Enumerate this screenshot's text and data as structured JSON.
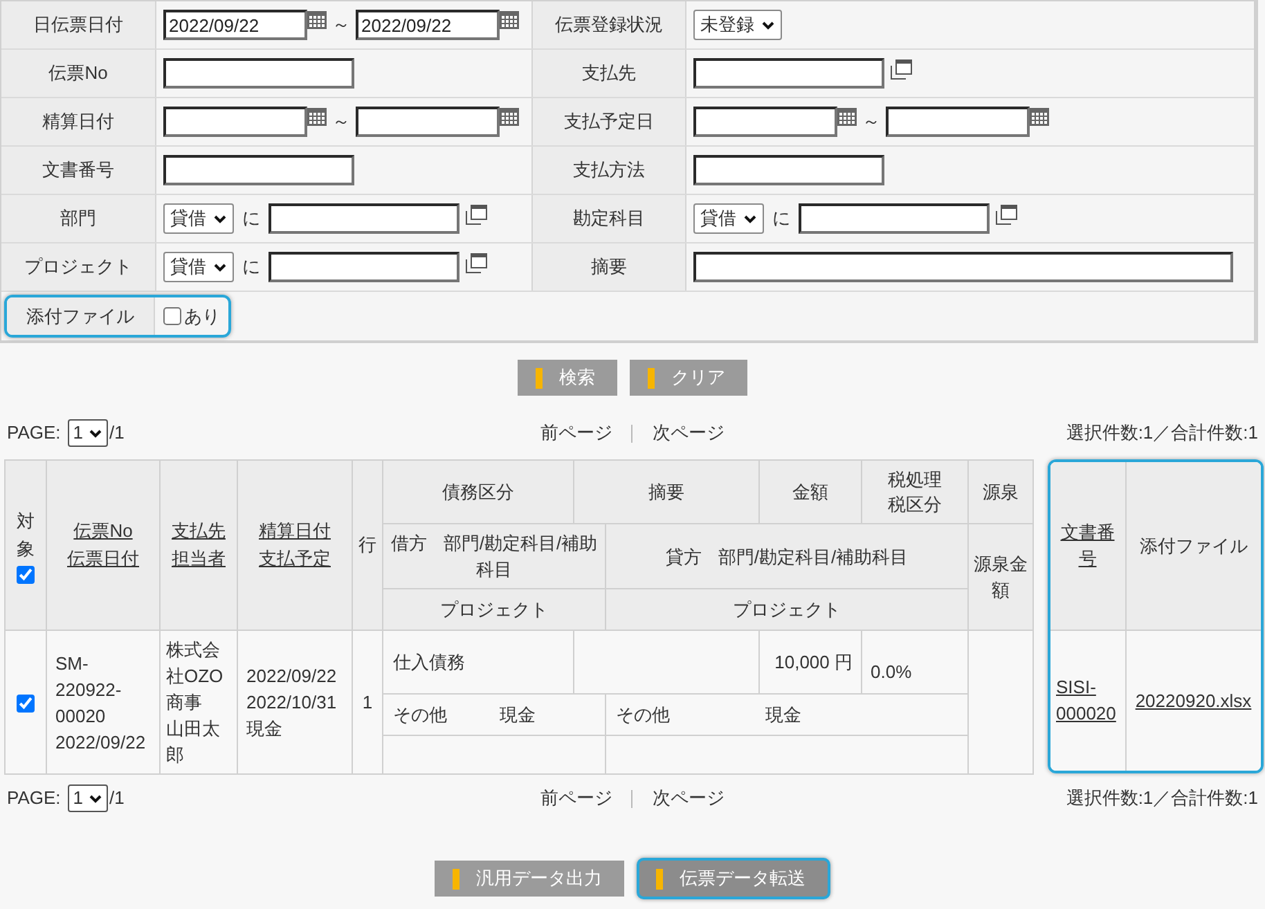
{
  "search_form": {
    "rows": [
      {
        "highlighted": false,
        "cells": [
          {
            "label": "日伝票日付",
            "field": {
              "kind": "date_range",
              "from": "2022/09/22",
              "to": "2022/09/22",
              "separator": "～"
            }
          },
          {
            "label": "伝票登録状況",
            "field": {
              "kind": "select",
              "value": "未登録"
            }
          }
        ]
      },
      {
        "highlighted": false,
        "cells": [
          {
            "label": "伝票No",
            "field": {
              "kind": "text"
            }
          },
          {
            "label": "支払先",
            "field": {
              "kind": "text_lookup"
            }
          }
        ]
      },
      {
        "highlighted": false,
        "cells": [
          {
            "label": "精算日付",
            "field": {
              "kind": "date_range",
              "separator": "～"
            }
          },
          {
            "label": "支払予定日",
            "field": {
              "kind": "date_range",
              "separator": "～"
            }
          }
        ]
      },
      {
        "highlighted": false,
        "cells": [
          {
            "label": "文書番号",
            "field": {
              "kind": "text"
            }
          },
          {
            "label": "支払方法",
            "field": {
              "kind": "text"
            }
          }
        ]
      },
      {
        "highlighted": false,
        "cells": [
          {
            "label": "部門",
            "field": {
              "kind": "select_lookup",
              "value": "貸借",
              "joiner": "に"
            }
          },
          {
            "label": "勘定科目",
            "field": {
              "kind": "select_lookup",
              "value": "貸借",
              "joiner": "に"
            }
          }
        ]
      },
      {
        "highlighted": false,
        "cells": [
          {
            "label": "プロジェクト",
            "field": {
              "kind": "select_lookup",
              "value": "貸借",
              "joiner": "に"
            }
          },
          {
            "label": "摘要",
            "field": {
              "kind": "wide_text"
            }
          }
        ]
      },
      {
        "highlighted": true,
        "cells": [
          {
            "label": "添付ファイル",
            "field": {
              "kind": "checkbox",
              "label": "あり",
              "checked": false
            }
          }
        ]
      }
    ]
  },
  "search_buttons": [
    {
      "label": "検索",
      "highlighted": false
    },
    {
      "label": "クリア",
      "highlighted": false
    }
  ],
  "pager_top": {
    "page_label": "PAGE:",
    "page": "1",
    "total": "/1",
    "prev": "前ページ",
    "next": "次ページ",
    "summary": "選択件数:1／合計件数:1"
  },
  "result_table": {
    "headers": {
      "select_all": {
        "label": "対象",
        "checked": true
      },
      "sort_headers": [
        [
          "伝票No",
          "伝票日付"
        ],
        [
          "支払先",
          "担当者"
        ],
        [
          "精算日付",
          "支払予定"
        ]
      ],
      "line": "行",
      "debt_type": "債務区分",
      "memo": "摘要",
      "amount": "金額",
      "tax": [
        "税処理",
        "税区分"
      ],
      "withholding": "源泉",
      "debit": {
        "side": "借方",
        "fields": "部門/勘定科目/補助科目"
      },
      "credit": {
        "side": "貸方",
        "fields": "部門/勘定科目/補助科目"
      },
      "withholding_amount": "源泉金額",
      "debit_project": "プロジェクト",
      "credit_project": "プロジェクト"
    },
    "rows": [
      {
        "checked": true,
        "slip_no": "SM-220922-00020",
        "slip_date": "2022/09/22",
        "payee": "株式会社OZO商事",
        "person": "山田太郎",
        "settle_date": "2022/09/22",
        "pay_date": "2022/10/31",
        "pay_method": "現金",
        "line": "1",
        "debt_type": "仕入債務",
        "amount": "10,000 円",
        "tax": "0.0%",
        "debit": {
          "dept": "その他",
          "account": "現金"
        },
        "credit": {
          "dept": "その他",
          "account": "現金"
        }
      }
    ]
  },
  "document_table": {
    "highlighted": true,
    "columns": [
      {
        "label": "文書番号",
        "sortable": true
      },
      {
        "label": "添付ファイル",
        "sortable": false
      }
    ],
    "rows": [
      {
        "doc_no": "SISI-000020",
        "file": "20220920.xlsx"
      }
    ]
  },
  "pager_bottom": {
    "page_label": "PAGE:",
    "page": "1",
    "total": "/1",
    "prev": "前ページ",
    "next": "次ページ",
    "summary": "選択件数:1／合計件数:1"
  },
  "action_buttons": [
    {
      "label": "汎用データ出力",
      "highlighted": false
    },
    {
      "label": "伝票データ転送",
      "highlighted": true
    }
  ]
}
